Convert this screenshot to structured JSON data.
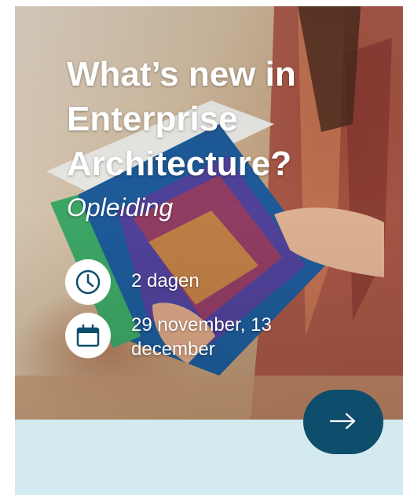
{
  "card": {
    "title": "What’s new in Enterprise Architecture?",
    "subtitle": "Opleiding",
    "duration": {
      "icon": "clock-icon",
      "text": "2 dagen"
    },
    "dates": {
      "icon": "calendar-icon",
      "text": "29 november, 13 december"
    },
    "next_button": {
      "icon": "arrow-right-icon"
    }
  },
  "colors": {
    "accent": "#0e4d6b",
    "band": "#d2eaf0",
    "text": "#ffffff"
  }
}
